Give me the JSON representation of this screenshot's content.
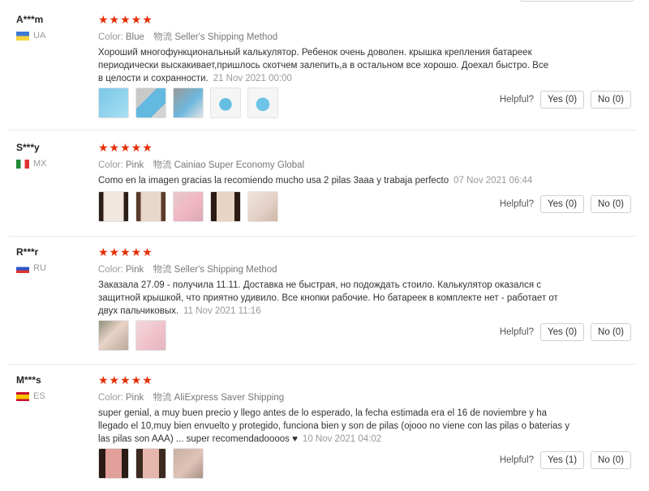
{
  "reviews": [
    {
      "user": "A***m",
      "country": "UA",
      "stars": "★★★★★",
      "color_label": "Color:",
      "color_value": "Blue",
      "shipping_label": "物流",
      "shipping_value": "Seller's Shipping Method",
      "text": "Хороший многофункциональный калькулятор. Ребенок очень доволен. крышка крепления батареек периодически выскакивает,пришлось скотчем залепить,а в остальном все хорошо. Доехал быстро. Все в целости и сохранности.",
      "date": "21 Nov 2021 00:00",
      "helpful_label": "Helpful?",
      "yes": "Yes (0)",
      "no": "No (0)"
    },
    {
      "user": "S***y",
      "country": "MX",
      "stars": "★★★★★",
      "color_label": "Color:",
      "color_value": "Pink",
      "shipping_label": "物流",
      "shipping_value": "Cainiao Super Economy Global",
      "text": "Como en la imagen gracias la recomiendo mucho usa 2 pilas 3aaa y trabaja perfecto",
      "date": "07 Nov 2021 06:44",
      "helpful_label": "Helpful?",
      "yes": "Yes (0)",
      "no": "No (0)"
    },
    {
      "user": "R***r",
      "country": "RU",
      "stars": "★★★★★",
      "color_label": "Color:",
      "color_value": "Pink",
      "shipping_label": "物流",
      "shipping_value": "Seller's Shipping Method",
      "text": "Заказала 27.09 - получила 11.11. Доставка не быстрая, но подождать стоило. Калькулятор оказался с защитной крышкой, что приятно удивило. Все кнопки рабочие. Но батареек в комплекте нет - работает от двух пальчиковых.",
      "date": "11 Nov 2021 11:16",
      "helpful_label": "Helpful?",
      "yes": "Yes (0)",
      "no": "No (0)"
    },
    {
      "user": "M***s",
      "country": "ES",
      "stars": "★★★★★",
      "color_label": "Color:",
      "color_value": "Pink",
      "shipping_label": "物流",
      "shipping_value": "AliExpress Saver Shipping",
      "text": "super genial, a muy buen precio y llego antes de lo esperado, la fecha estimada era el 16 de noviembre y ha llegado el 10,muy bien envuelto y protegido, funciona bien y son de pilas (ojooo no viene con las pilas o baterias y las pilas son AAA) ... super recomendadoooos ♥",
      "date": "10 Nov 2021 04:02",
      "helpful_label": "Helpful?",
      "yes": "Yes (1)",
      "no": "No (0)"
    }
  ]
}
